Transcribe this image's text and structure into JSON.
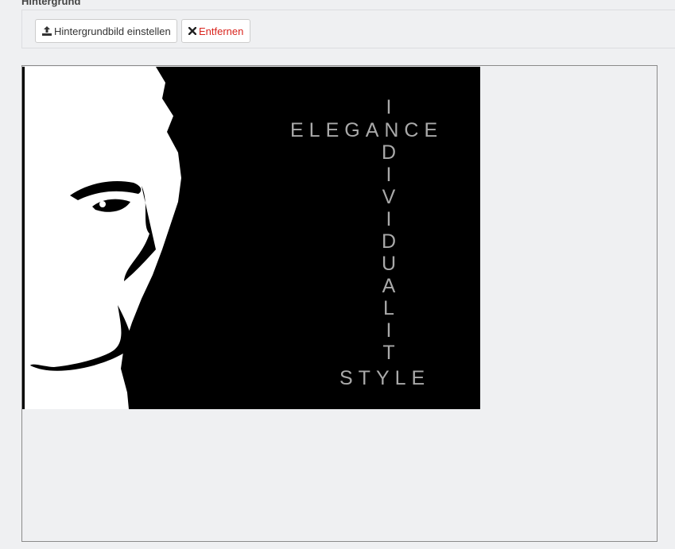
{
  "section": {
    "label": "Hintergrund"
  },
  "toolbar": {
    "upload_label": "Hintergrundbild einstellen",
    "upload_icon": "upload-icon",
    "remove_label": "Entfernen",
    "remove_icon": "close-icon"
  },
  "preview": {
    "text_line1": "ELEGANCE",
    "text_vertical": [
      "I",
      "N",
      "D",
      "I",
      "V",
      "I",
      "D",
      "U",
      "A",
      "L",
      "I",
      "T"
    ],
    "text_line2": "STYLE"
  },
  "colors": {
    "page_bg": "#eff0f2",
    "remove_text": "#d9241d",
    "image_text": "#a9a9a9"
  }
}
